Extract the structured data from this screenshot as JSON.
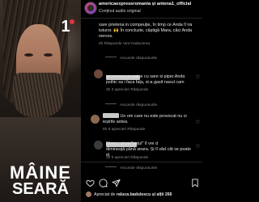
{
  "post": {
    "account": "americaexpressromania",
    "coauthor": "antena1_official",
    "subtitle": "Conținut audio original",
    "promo_line1": "MÂINE",
    "promo_line2": "SEARĂ",
    "channel_logo": "1"
  },
  "comments": [
    {
      "lines": [
        "sare prietena in compeuție, în timp ce Anda îl ira",
        "tuturor. 🙌 În concluzie, câștigă Mara, căci Anda",
        "nervos."
      ],
      "meta": "5h  Răspunde  Vezi traducerea",
      "view_replies": "Ascunde răspunsurile"
    },
    {
      "lines_head": "",
      "line1_tail": "",
      "lines": [
        "va manca pe paine cu sare si piper.Anda",
        "psihic sa i faca fața, si-a gasit nasul cam"
      ],
      "meta": "3h  3 aprecieri  Răspunde",
      "view_replies": "Ascunde răspunsurile"
    },
    {
      "lines": [
        "Un om care nu este provocat nu cr",
        "ieșirile astea."
      ],
      "meta": "8h  6 aprecieri  Răspunde"
    },
    {
      "lines": [
        "El nu... și pe \"soțul\" îl vre d",
        "dimineață până seara. Și îl văd cât se poate",
        "el."
      ],
      "meta": "3h  6 aprecieri  Răspunde",
      "view_replies": "Ascunde răspunsurile"
    }
  ],
  "footer": {
    "liked_by_prefix": "Apreciat de",
    "liked_by_user": "raluca.badulescu",
    "liked_by_suffix": "și alții 266"
  },
  "icons": [
    "heart-icon",
    "comment-icon",
    "share-icon",
    "bookmark-icon"
  ]
}
